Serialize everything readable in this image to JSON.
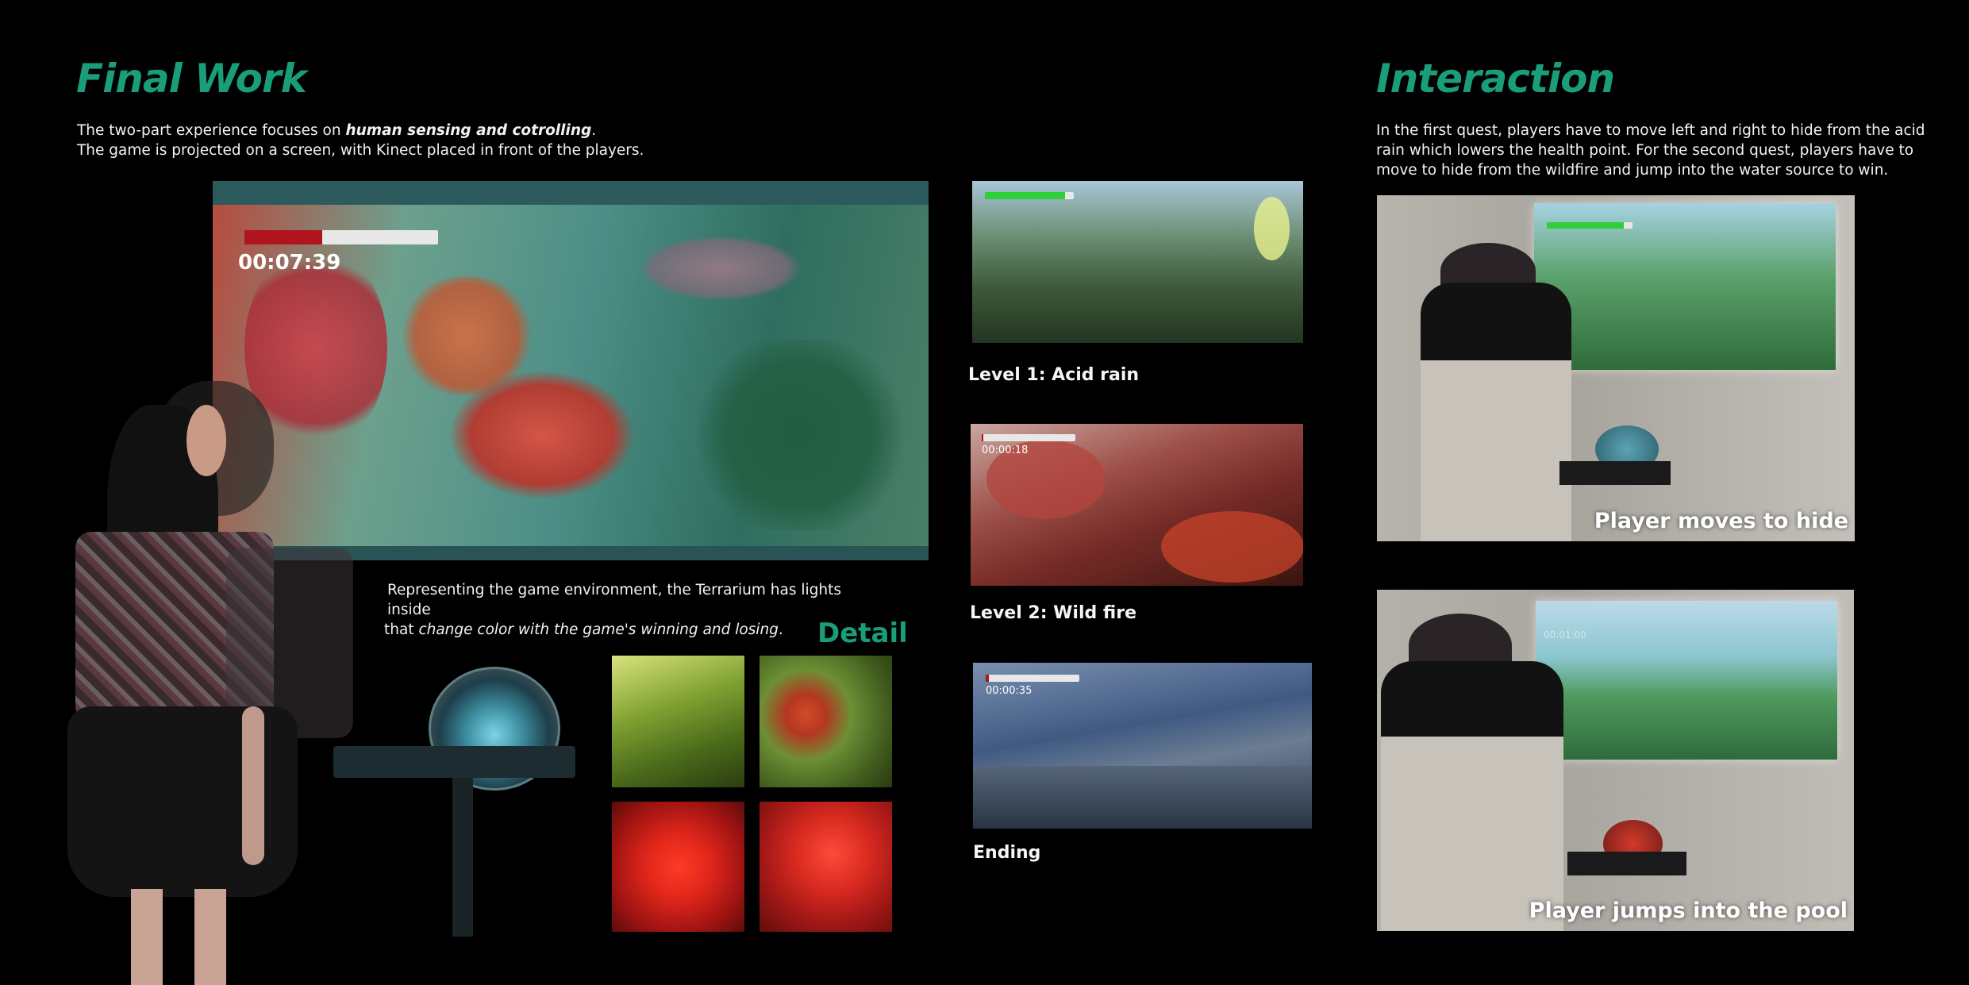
{
  "final_work": {
    "title": "Final Work",
    "intro_line1_prefix": "The two-part experience focuses on ",
    "intro_line1_emph": "human sensing and cotrolling",
    "intro_line1_suffix": ".",
    "intro_line2": "The game is projected on a screen, with Kinect placed in front of the players.",
    "main_timer": "00:07:39",
    "terrarium_line1": "Representing the game environment, the Terrarium has lights inside",
    "terrarium_line2_prefix": "that ",
    "terrarium_line2_emph": "change color with the game's winning and losing",
    "terrarium_line2_suffix": ".",
    "detail_title": "Detail"
  },
  "levels": [
    {
      "caption": "Level 1: Acid rain",
      "timer": ""
    },
    {
      "caption": "Level 2: Wild fire",
      "timer": "00:00:18"
    },
    {
      "caption": "Ending",
      "timer": "00:00:35"
    }
  ],
  "interaction": {
    "title": "Interaction",
    "text_line1": "In the first quest, players have to move left and right to hide from the acid",
    "text_line2": "rain which lowers the health point. For the second quest, players have to",
    "text_line3": "move to hide from the wildfire and jump into the water source to win.",
    "photo1_caption": "Player moves to hide",
    "photo2_caption": "Player jumps into the pool",
    "photo2_timer": "00:01:00"
  },
  "colors": {
    "accent": "#1a9e7a",
    "health_red": "#b0141c",
    "health_green": "#2fcf3a"
  },
  "hud": {
    "main_health": 0.4,
    "level1_health": 0.9,
    "level2_health": 0.02,
    "ending_health": 0.03,
    "photo1_health": 0.9
  }
}
